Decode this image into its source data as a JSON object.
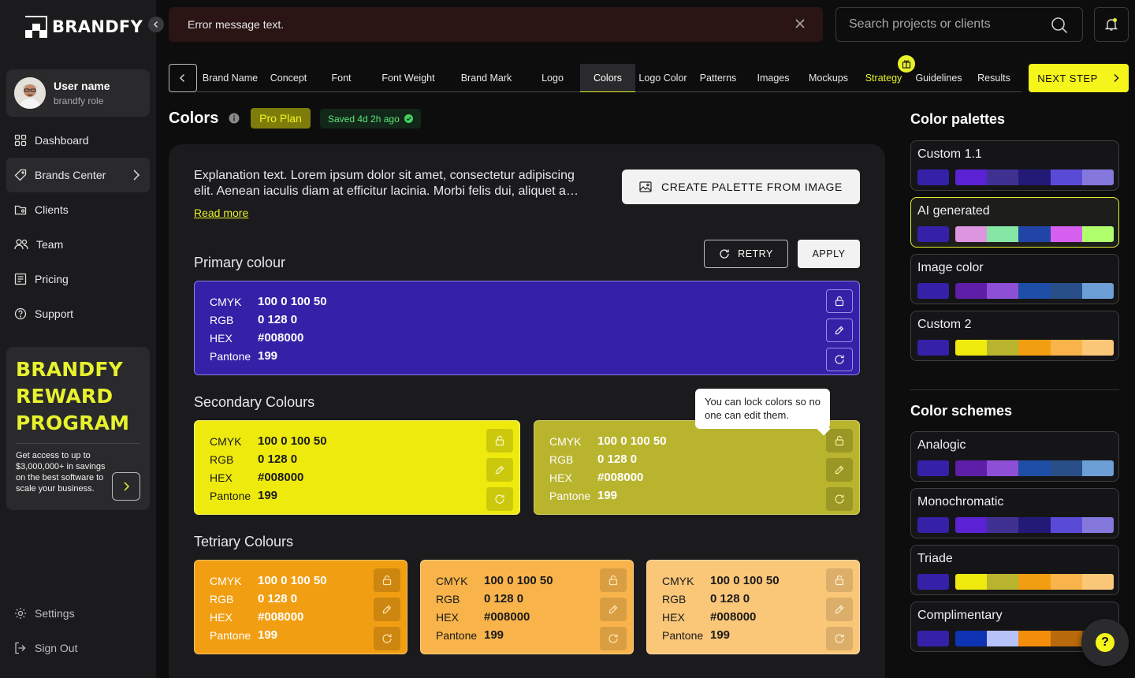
{
  "brand": {
    "name": "BRANDFY"
  },
  "user": {
    "name": "User name",
    "role": "brandfy role"
  },
  "nav": [
    {
      "label": "Dashboard",
      "icon": "grid-icon"
    },
    {
      "label": "Brands Center",
      "icon": "tag-icon"
    },
    {
      "label": "Clients",
      "icon": "folder-user-icon"
    },
    {
      "label": "Team",
      "icon": "users-icon"
    },
    {
      "label": "Pricing",
      "icon": "receipt-icon"
    },
    {
      "label": "Support",
      "icon": "help-circle-icon"
    }
  ],
  "reward": {
    "title_lines": [
      "BRANDFY",
      "REWARD",
      "PROGRAM"
    ],
    "text": "Get access to up to $3,000,000+ in savings on the best software to scale your business."
  },
  "bottom_nav": [
    {
      "label": "Settings",
      "icon": "gear-icon"
    },
    {
      "label": "Sign Out",
      "icon": "sign-out-icon"
    }
  ],
  "error": {
    "text": "Error message text."
  },
  "search": {
    "placeholder": "Search projects or clients"
  },
  "steps": [
    "Brand Name",
    "Concept",
    "Font",
    "Font Weight",
    "Brand Mark",
    "Logo",
    "Colors",
    "Logo Color",
    "Patterns",
    "Images",
    "Mockups",
    "Strategy",
    "Guidelines",
    "Results"
  ],
  "active_step": "Colors",
  "next_step_label": "NEXT STEP",
  "page": {
    "title": "Colors",
    "plan": "Pro Plan",
    "saved": "Saved 4d 2h ago",
    "explanation": "Explanation text. Lorem ipsum dolor sit amet, consectetur adipiscing elit. Aenean iaculis  diam at efficitur lacinia. Morbi felis dui, aliquet a…",
    "read_more": "Read more",
    "create_btn": "CREATE PALETTE FROM IMAGE",
    "retry": "RETRY",
    "apply": "APPLY",
    "primary_title": "Primary colour",
    "secondary_title": "Secondary Colours",
    "tertiary_title": "Tetriary Colours",
    "tooltip": "You can lock colors so no one can edit them."
  },
  "color_labels": {
    "cmyk": "CMYK",
    "rgb": "RGB",
    "hex": "HEX",
    "pantone": "Pantone"
  },
  "colors": {
    "primary": {
      "bg": "#3421a8",
      "cmyk": "100 0 100 50",
      "rgb": "0 128 0",
      "hex": "#008000",
      "pantone": "199"
    },
    "secondary": [
      {
        "bg": "#eeea0e",
        "cmyk": "100 0 100 50",
        "rgb": "0 128 0",
        "hex": "#008000",
        "pantone": "199"
      },
      {
        "bg": "#b9b42e",
        "cmyk": "100 0 100 50",
        "rgb": "0 128 0",
        "hex": "#008000",
        "pantone": "199"
      }
    ],
    "tertiary": [
      {
        "bg": "#f19e12",
        "cmyk": "100 0 100 50",
        "rgb": "0 128 0",
        "hex": "#008000",
        "pantone": "199"
      },
      {
        "bg": "#f8b44b",
        "cmyk": "100 0 100 50",
        "rgb": "0 128 0",
        "hex": "#008000",
        "pantone": "199"
      },
      {
        "bg": "#fac678",
        "cmyk": "100 0 100 50",
        "rgb": "0 128 0",
        "hex": "#008000",
        "pantone": "199"
      }
    ]
  },
  "palettes_title": "Color palettes",
  "palettes": [
    {
      "name": "Custom 1.1",
      "primary": "#3421a8",
      "swatches": [
        "#5a22d2",
        "#3f3192",
        "#231a78",
        "#5a4bd6",
        "#8578dc"
      ]
    },
    {
      "name": "AI generated",
      "primary": "#3421a8",
      "swatches": [
        "#dd95e0",
        "#86e6a4",
        "#2145a6",
        "#d75ff0",
        "#b0ff6c"
      ],
      "selected": true
    },
    {
      "name": "Image color",
      "primary": "#3421a8",
      "swatches": [
        "#5e1ea8",
        "#8d4fd6",
        "#1e4ea5",
        "#284f88",
        "#6c9fd6"
      ]
    },
    {
      "name": "Custom 2",
      "primary": "#3421a8",
      "swatches": [
        "#eeea0e",
        "#b9b42e",
        "#f19e12",
        "#f8b44b",
        "#fac678"
      ]
    }
  ],
  "schemes_title": "Color schemes",
  "schemes": [
    {
      "name": "Analogic",
      "primary": "#3421a8",
      "swatches": [
        "#5e1ea8",
        "#8d4fd6",
        "#1e4ea5",
        "#284f88",
        "#6c9fd6"
      ]
    },
    {
      "name": "Monochromatic",
      "primary": "#3421a8",
      "swatches": [
        "#5a22d2",
        "#3f3192",
        "#231a78",
        "#5a4bd6",
        "#8578dc"
      ]
    },
    {
      "name": "Triade",
      "primary": "#3421a8",
      "swatches": [
        "#eeea0e",
        "#b9b42e",
        "#f19e12",
        "#f8b44b",
        "#fac678"
      ]
    },
    {
      "name": "Complimentary",
      "primary": "#3421a8",
      "swatches": [
        "#0e34b4",
        "#b7c3f8",
        "#f48c0c",
        "#b86a0c",
        "#7a4a10"
      ]
    }
  ],
  "help": "?"
}
